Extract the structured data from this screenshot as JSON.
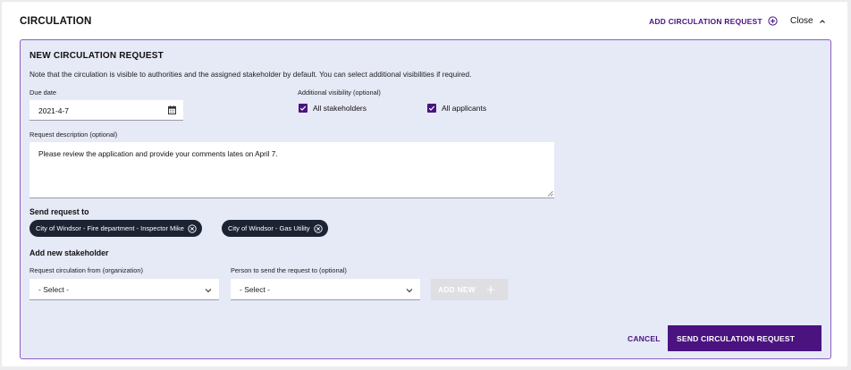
{
  "header": {
    "title": "CIRCULATION",
    "add_request_label": "ADD CIRCULATION REQUEST",
    "close_label": "Close"
  },
  "form": {
    "title": "NEW CIRCULATION REQUEST",
    "note": "Note that the circulation is visible to authorities and the assigned stakeholder by default. You can select additional visibilities if required.",
    "due_date": {
      "label": "Due date",
      "value": "2021-4-7"
    },
    "visibility": {
      "label": "Additional visibility (optional)",
      "options": [
        {
          "label": "All stakeholders",
          "checked": true
        },
        {
          "label": "All applicants",
          "checked": true
        }
      ]
    },
    "description": {
      "label": "Request description (optional)",
      "value": "Please review the application and provide your comments lates on April 7."
    },
    "send_to": {
      "label": "Send request to",
      "chips": [
        "City of Windsor - Fire department - Inspector Mike",
        "City of Windsor - Gas Utility"
      ]
    },
    "new_stakeholder": {
      "label": "Add new stakeholder",
      "org_label": "Request circulation from (organization)",
      "org_value": "- Select -",
      "person_label": "Person to send the request to (optional)",
      "person_value": "- Select -",
      "add_new_label": "ADD NEW"
    },
    "actions": {
      "cancel_label": "CANCEL",
      "send_label": "SEND CIRCULATION REQUEST"
    }
  },
  "colors": {
    "accent": "#4a1380",
    "form_bg": "#e6e9f6",
    "chip_bg": "#1c2333"
  }
}
